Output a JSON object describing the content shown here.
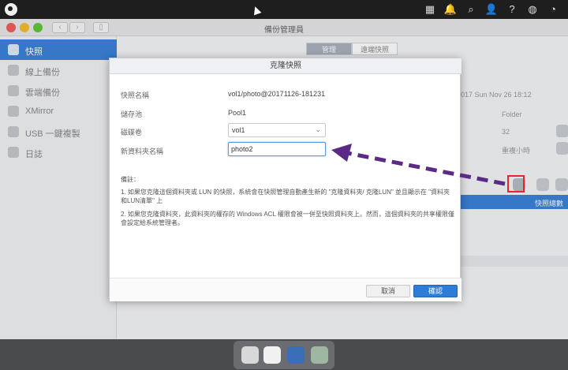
{
  "window": {
    "title": "備份管理員"
  },
  "sidebar": {
    "items": [
      {
        "label": "快照",
        "active": true
      },
      {
        "label": "線上備份",
        "active": false
      },
      {
        "label": "雲端備份",
        "active": false
      },
      {
        "label": "XMirror",
        "active": false
      },
      {
        "label": "USB 一鍵複製",
        "active": false
      },
      {
        "label": "日誌",
        "active": false
      }
    ]
  },
  "tabs": [
    {
      "label": "管理",
      "active": true
    },
    {
      "label": "遠端快照",
      "active": false
    }
  ],
  "background": {
    "date_fragment": "017 Sun Nov 26 18:12",
    "col_folder": "Folder",
    "row_number": "32",
    "row_text": "重複小時",
    "row_blue_text": "快照總數"
  },
  "dialog": {
    "title": "克隆快照",
    "fields": {
      "snapshot_name_label": "快照名稱",
      "snapshot_name_value": "vol1/photo@20171126-181231",
      "pool_label": "儲存池",
      "pool_value": "Pool1",
      "volume_label": "磁碟卷",
      "volume_value": "vol1",
      "new_folder_label": "新資料夾名稱",
      "new_folder_value": "photo2"
    },
    "notes": {
      "heading": "備註：",
      "note1": "1. 如果您克隆這個資料夾或 LUN 的快照，系統會在快照管理自動產生新的 \"克隆資料夾/ 克隆LUN\" 並且顯示在 \"資料夾和LUN清單\" 上",
      "note2": "2. 如果您克隆資料夾，此資料夾的權存的 Windows ACL 權限會被一併至快照資料夾上。然而，這個資料夾的共享權限僅會設定給系統管理者。"
    },
    "buttons": {
      "cancel": "取消",
      "confirm": "確認"
    }
  },
  "colors": {
    "accent": "#3b82d9",
    "arrow": "#5b2a86",
    "highlight_box": "#e0282e"
  }
}
